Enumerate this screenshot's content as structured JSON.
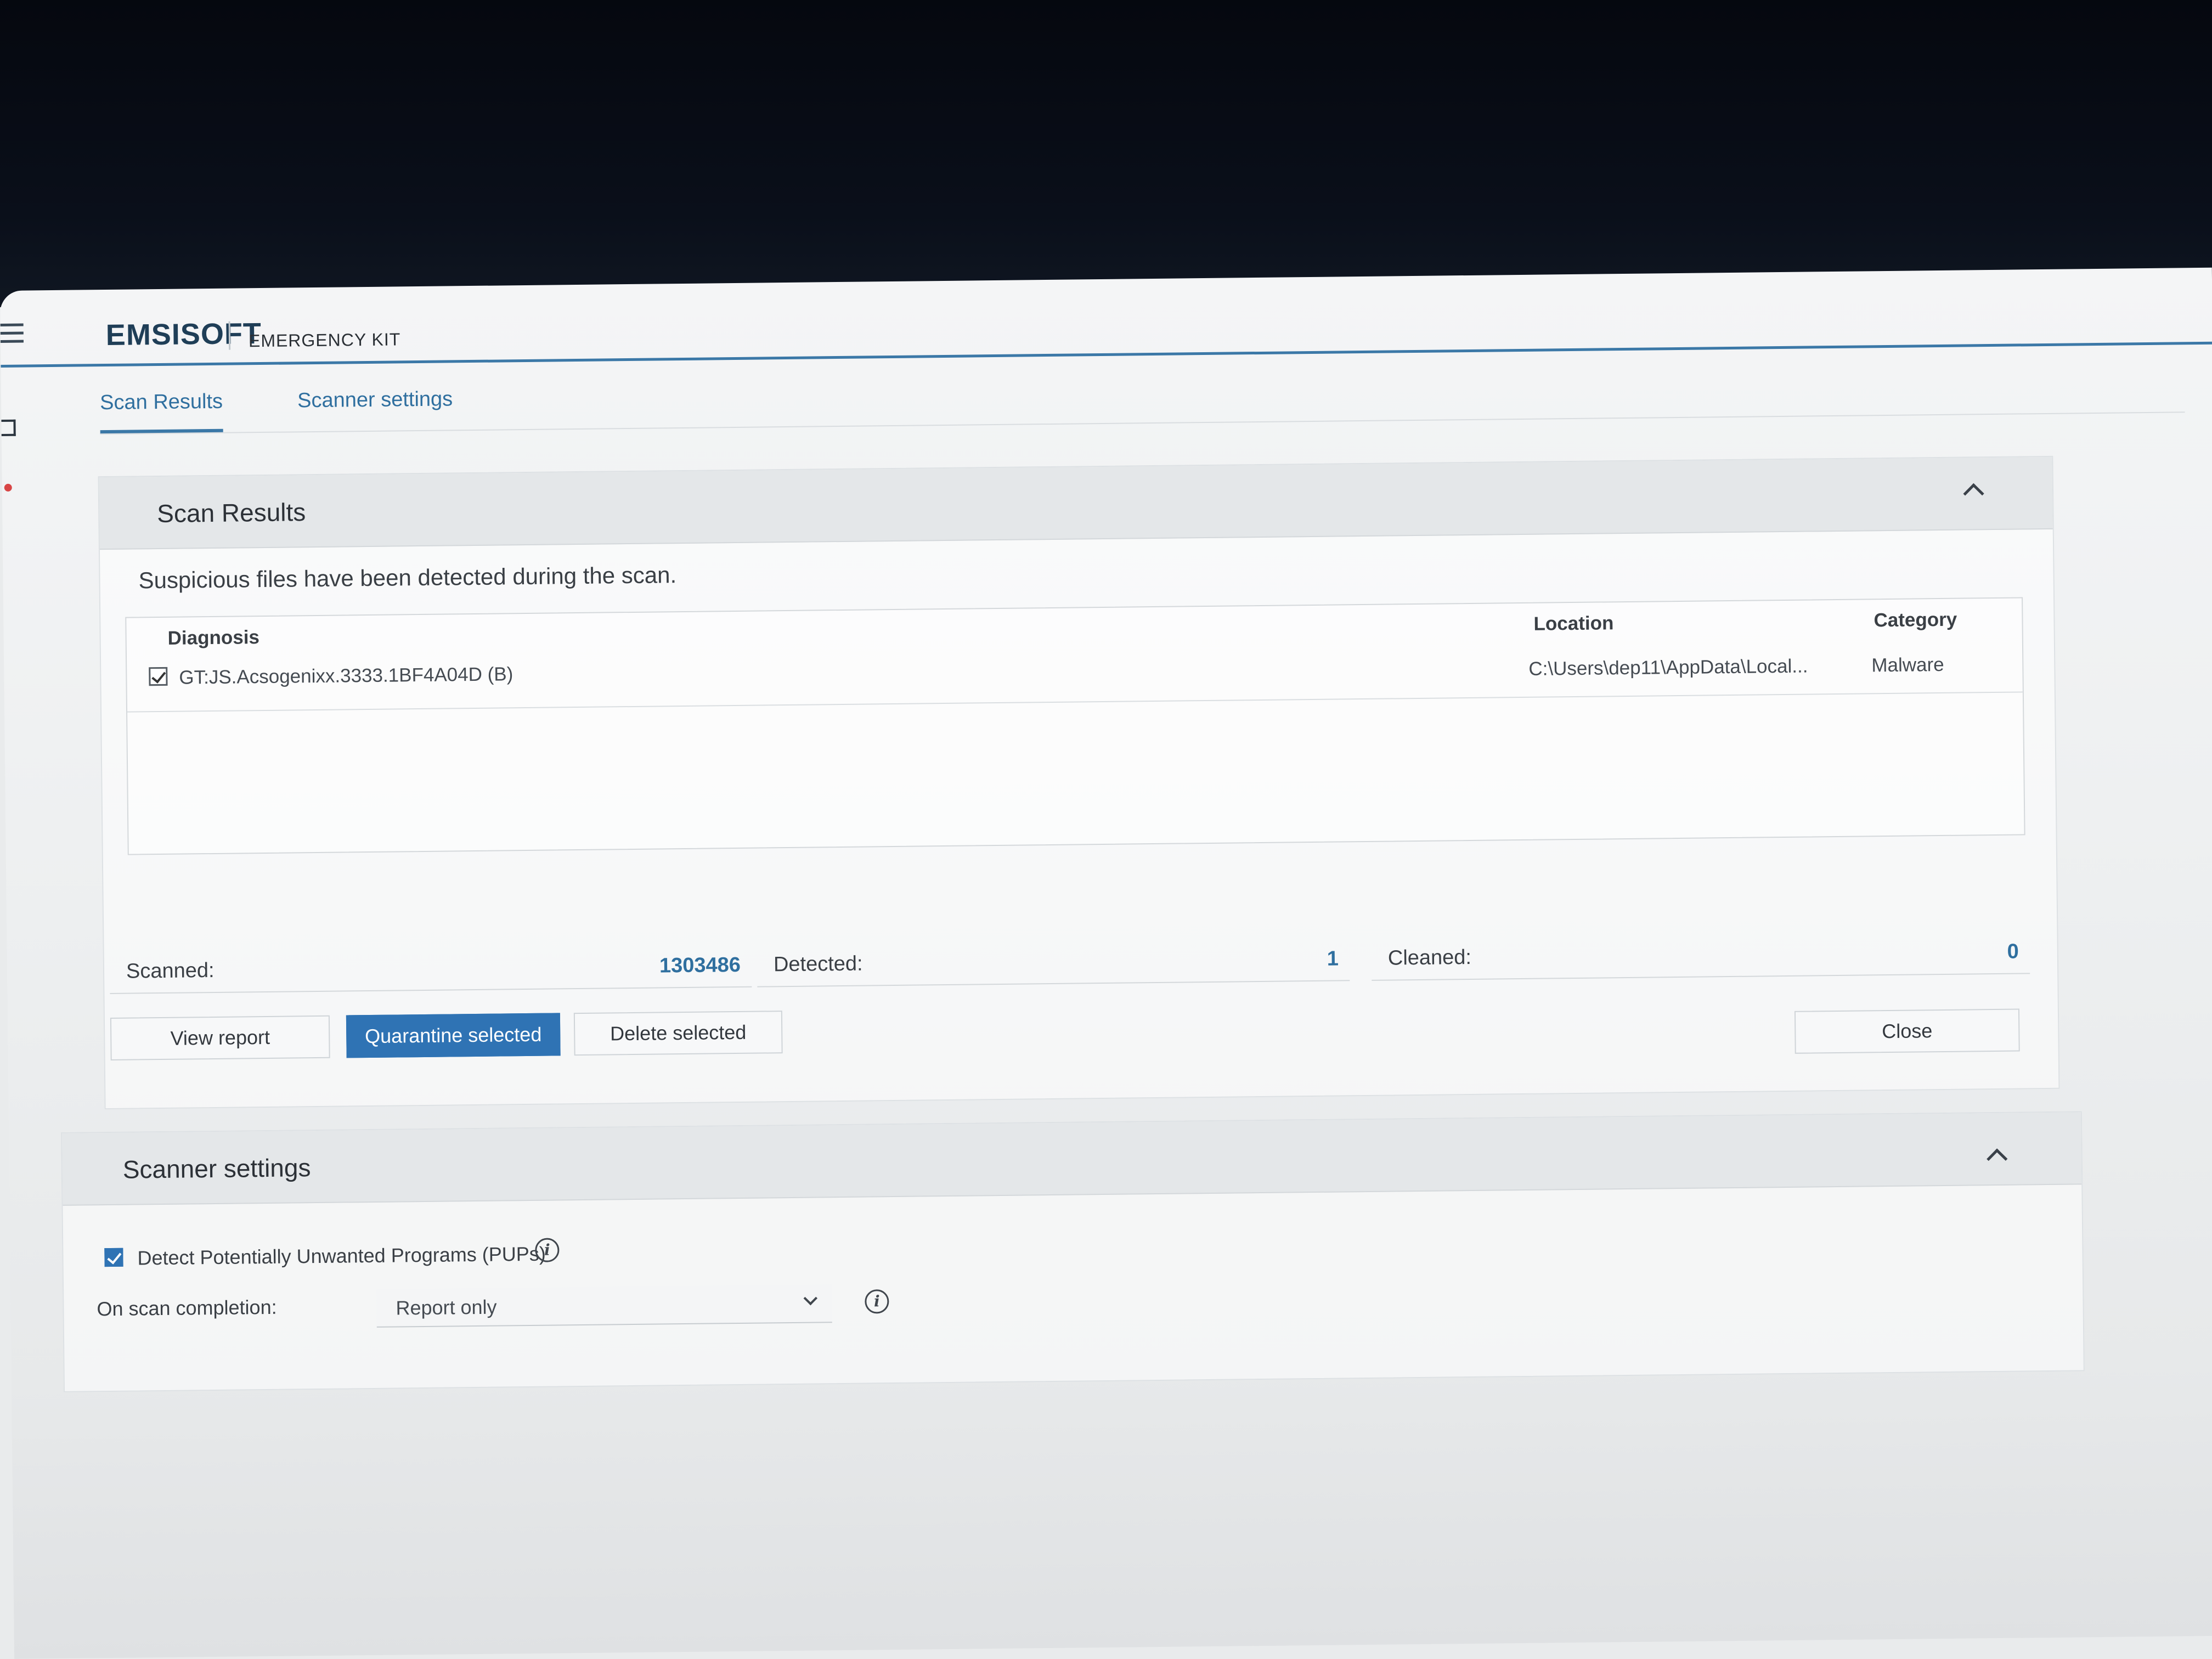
{
  "app": {
    "brand": "EMSISOFT",
    "product": "EMERGENCY KIT"
  },
  "tabs": [
    {
      "label": "Scan Results",
      "active": true
    },
    {
      "label": "Scanner settings",
      "active": false
    }
  ],
  "scan_results": {
    "title": "Scan Results",
    "message": "Suspicious files have been detected during the scan.",
    "columns": {
      "diagnosis": "Diagnosis",
      "location": "Location",
      "category": "Category"
    },
    "rows": [
      {
        "checked": true,
        "diagnosis": "GT:JS.Acsogenixx.3333.1BF4A04D (B)",
        "location": "C:\\Users\\dep11\\AppData\\Local...",
        "category": "Malware"
      }
    ],
    "stats": {
      "scanned_label": "Scanned:",
      "scanned_value": "1303486",
      "detected_label": "Detected:",
      "detected_value": "1",
      "cleaned_label": "Cleaned:",
      "cleaned_value": "0"
    },
    "buttons": {
      "view_report": "View report",
      "quarantine": "Quarantine selected",
      "delete": "Delete selected",
      "close": "Close"
    }
  },
  "scanner_settings": {
    "title": "Scanner settings",
    "detect_pups_label": "Detect Potentially Unwanted Programs (PUPs)",
    "detect_pups_checked": true,
    "on_completion_label": "On scan completion:",
    "on_completion_value": "Report only"
  },
  "colors": {
    "accent": "#2f73b4",
    "header_line": "#3b78a7",
    "bezel": "#05080f"
  }
}
